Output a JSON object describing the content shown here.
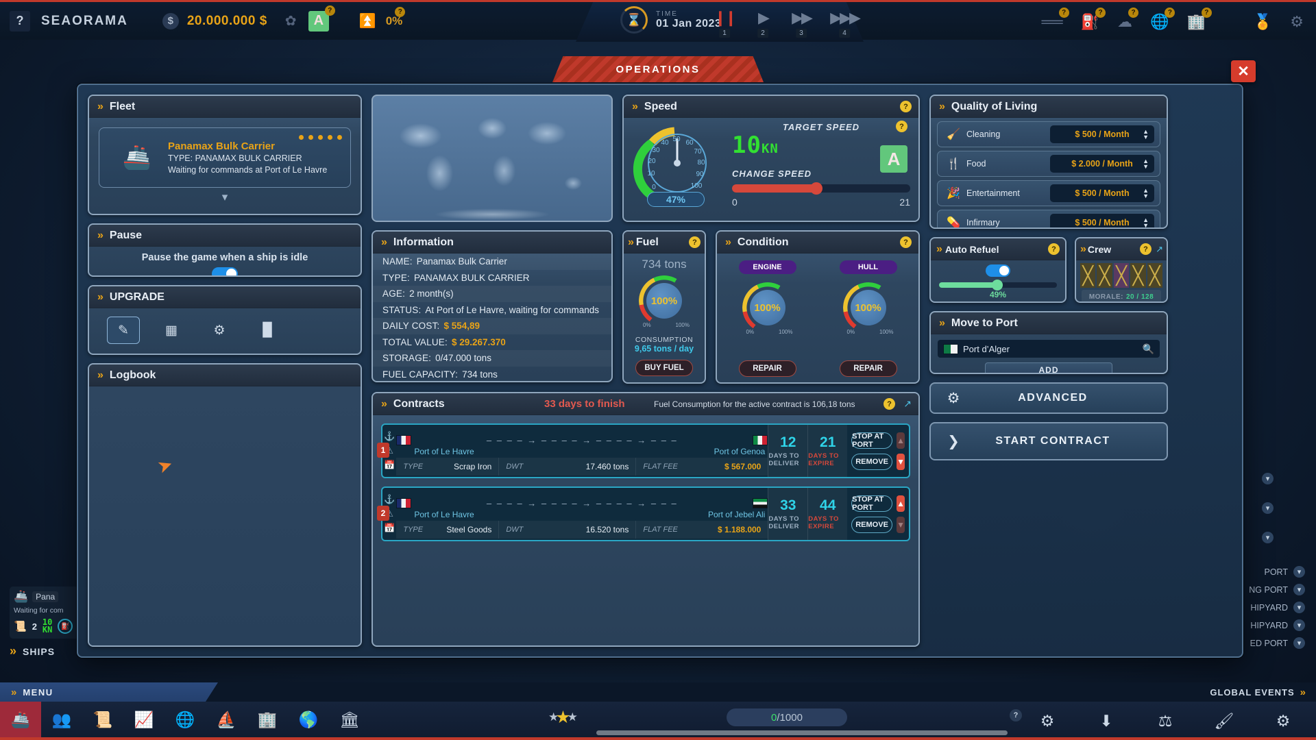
{
  "topbar": {
    "help_label": "?",
    "title": "SEAORAMA",
    "money": "20.000.000 $",
    "eco_grade": "A",
    "eco_pct": "0%",
    "time_label": "TIME",
    "date": "01 Jan 2023",
    "speed_buttons": [
      "1",
      "2",
      "3",
      "4"
    ],
    "right_icons": [
      "books-icon",
      "fuel-pump-icon",
      "cloud-ship-icon",
      "globe-money-icon",
      "office-building-icon",
      "medal-icon",
      "gear-icon"
    ]
  },
  "banner": {
    "title": "OPERATIONS",
    "close_label": "✕"
  },
  "fleet": {
    "title": "Fleet",
    "ship": {
      "name": "Panamax Bulk Carrier",
      "type": "TYPE: PANAMAX BULK CARRIER",
      "status": "Waiting for commands at Port of Le Havre",
      "stars": 5
    }
  },
  "pause": {
    "title": "Pause",
    "text": "Pause the game when a ship is idle",
    "enabled": true
  },
  "upgrade": {
    "title": "UPGRADE",
    "buttons": [
      "pencil-icon",
      "layout-icon",
      "gear-icon",
      "paint-bucket-icon"
    ]
  },
  "logbook": {
    "title": "Logbook"
  },
  "information": {
    "title": "Information",
    "rows": [
      {
        "key": "NAME:",
        "value": "Panamax Bulk Carrier",
        "money": false
      },
      {
        "key": "TYPE:",
        "value": "PANAMAX BULK CARRIER",
        "money": false
      },
      {
        "key": "AGE:",
        "value": "2 month(s)",
        "money": false
      },
      {
        "key": "STATUS:",
        "value": "At Port of Le Havre, waiting for commands",
        "money": false
      },
      {
        "key": "DAILY COST:",
        "value": "$ 554,89",
        "money": true
      },
      {
        "key": "TOTAL VALUE:",
        "value": "$ 29.267.370",
        "money": true
      },
      {
        "key": "STORAGE:",
        "value": "0/47.000 tons",
        "money": false
      },
      {
        "key": "FUEL CAPACITY:",
        "value": "734 tons",
        "money": false
      }
    ]
  },
  "speed": {
    "title": "Speed",
    "gauge_percent": "47%",
    "gauge_ticks": [
      "0",
      "10",
      "20",
      "30",
      "40",
      "50",
      "60",
      "70",
      "80",
      "90",
      "100"
    ],
    "target_speed_label": "TARGET SPEED",
    "target_speed_value": "10",
    "target_speed_unit": "KN",
    "grade": "A",
    "change_speed_label": "CHANGE SPEED",
    "range_min": "0",
    "range_max": "21"
  },
  "fuel": {
    "title": "Fuel",
    "tons": "734 tons",
    "gauge_value": "100%",
    "gauge_min": "0%",
    "gauge_max": "100%",
    "consumption_label": "CONSUMPTION",
    "consumption_value": "9,65 tons / day",
    "buy_label": "BUY FUEL"
  },
  "condition": {
    "title": "Condition",
    "items": [
      {
        "tag": "ENGINE",
        "value": "100%",
        "min": "0%",
        "max": "100%",
        "button": "REPAIR"
      },
      {
        "tag": "HULL",
        "value": "100%",
        "min": "0%",
        "max": "100%",
        "button": "REPAIR"
      }
    ]
  },
  "contracts": {
    "title": "Contracts",
    "days_to_finish": "33 days to finish",
    "note": "Fuel Consumption for the active contract is 106,18 tons",
    "rows": [
      {
        "index": "1",
        "from": "Port of Le Havre",
        "to": "Port of Genoa",
        "from_flag": "flag-fr",
        "to_flag": "flag-it",
        "type_label": "TYPE",
        "type_value": "Scrap Iron",
        "dwt_label": "DWT",
        "dwt_value": "17.460 tons",
        "fee_label": "FLAT FEE",
        "fee_value": "$ 567.000",
        "deliver_num": "12",
        "deliver_label": "DAYS TO DELIVER",
        "expire_num": "21",
        "expire_label": "DAYS TO EXPIRE",
        "stop_label": "STOP AT PORT",
        "remove_label": "REMOVE",
        "up_active": false,
        "down_active": true
      },
      {
        "index": "2",
        "from": "Port of Le Havre",
        "to": "Port of Jebel Ali",
        "from_flag": "flag-fr",
        "to_flag": "flag-ae",
        "type_label": "TYPE",
        "type_value": "Steel Goods",
        "dwt_label": "DWT",
        "dwt_value": "16.520 tons",
        "fee_label": "FLAT FEE",
        "fee_value": "$ 1.188.000",
        "deliver_num": "33",
        "deliver_label": "DAYS TO DELIVER",
        "expire_num": "44",
        "expire_label": "DAYS TO EXPIRE",
        "stop_label": "STOP AT PORT",
        "remove_label": "REMOVE",
        "up_active": true,
        "down_active": false
      }
    ]
  },
  "quality_of_living": {
    "title": "Quality of Living",
    "rows": [
      {
        "icon": "cleaning-icon",
        "label": "Cleaning",
        "value": "$ 500 / Month"
      },
      {
        "icon": "food-icon",
        "label": "Food",
        "value": "$ 2.000 / Month"
      },
      {
        "icon": "entertainment-icon",
        "label": "Entertainment",
        "value": "$ 500 / Month"
      },
      {
        "icon": "infirmary-icon",
        "label": "Infirmary",
        "value": "$ 500 / Month"
      }
    ]
  },
  "auto_refuel": {
    "title": "Auto Refuel",
    "enabled": true,
    "percent": "49%"
  },
  "crew": {
    "title": "Crew",
    "morale_label": "MORALE:",
    "morale_value": "20 / 128"
  },
  "move_to_port": {
    "title": "Move to Port",
    "port_value": "Port d’Alger",
    "port_placeholder": "Port d’Alger",
    "add_label": "ADD"
  },
  "advanced_button": "ADVANCED",
  "start_contract_button": "START CONTRACT",
  "ship_widget": {
    "name": "Pana",
    "status": "Waiting for com",
    "contracts_count": "2",
    "speed": "10",
    "speed_unit": "KN"
  },
  "ships_label": "SHIPS",
  "port_list": [
    "PORT",
    "NG PORT",
    "HIPYARD",
    "HIPYARD",
    "ED PORT"
  ],
  "bottom": {
    "menu_label": "MENU",
    "global_events_label": "GLOBAL EVENTS",
    "icons": [
      "ship-icon",
      "crew-icon",
      "contracts-icon",
      "stats-icon",
      "world-money-icon",
      "ship-buy-icon",
      "company-icon",
      "world-port-icon",
      "bank-icon"
    ],
    "xp": "0/1000",
    "xp_current": "0",
    "xp_max": "/1000",
    "right_icons": [
      "gears-icon",
      "download-icon",
      "balance-icon",
      "brush-icon",
      "settings-icon"
    ]
  },
  "colors": {
    "accent_orange": "#e8a317",
    "accent_red": "#c0392b",
    "accent_cyan": "#2fd3e8",
    "accent_green": "#32e032"
  }
}
